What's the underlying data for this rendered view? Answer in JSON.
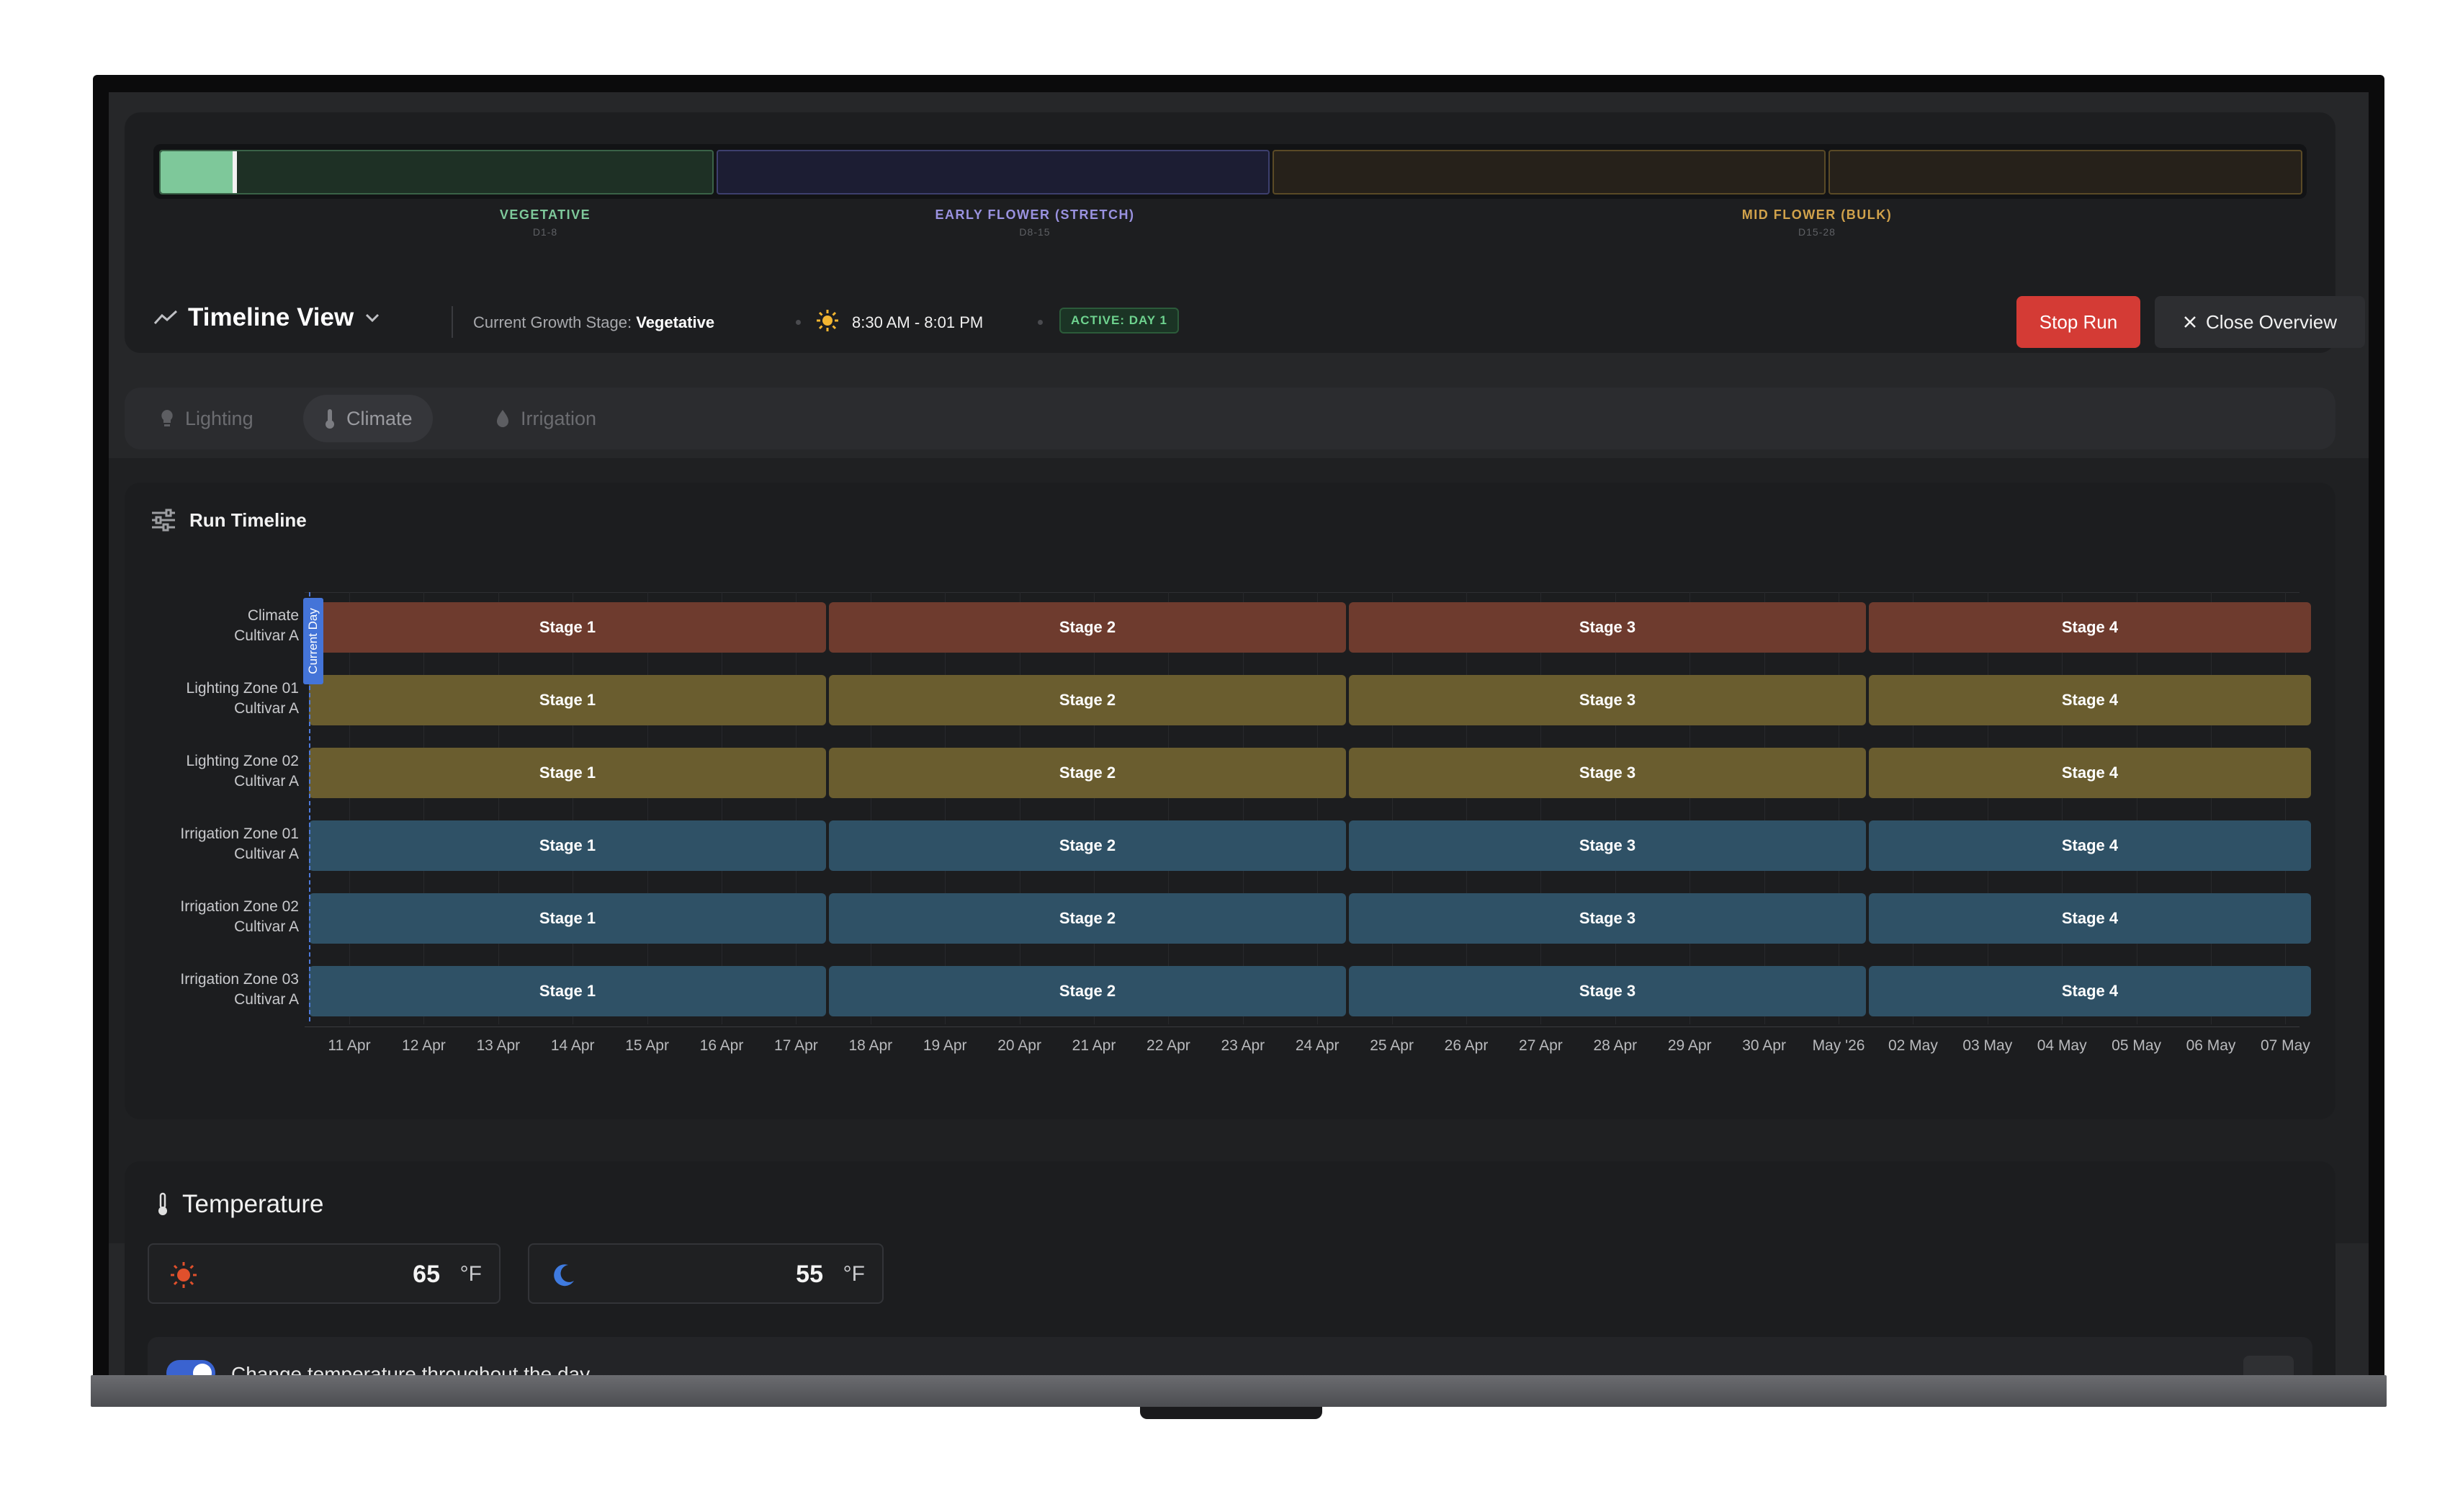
{
  "stage_bar": {
    "vegetative_label": "VEGETATIVE",
    "vegetative_range": "D1-8",
    "early_flower_label": "EARLY FLOWER (STRETCH)",
    "early_flower_range": "D8-15",
    "mid_flower_label": "MID FLOWER (BULK)",
    "mid_flower_range": "D15-28",
    "vegetative_progress_fraction": 0.13,
    "colors": {
      "vegetative": "#7ec89a",
      "early_flower": "#9a92e0",
      "mid_flower": "#d1a24b"
    }
  },
  "header": {
    "view_title": "Timeline View",
    "growth_stage_label": "Current Growth Stage:",
    "growth_stage_value": "Vegetative",
    "light_schedule": "8:30 AM - 8:01 PM",
    "active_badge": "ACTIVE: DAY 1",
    "stop_button": "Stop Run",
    "close_button": "Close Overview"
  },
  "tabs": [
    {
      "label": "Lighting",
      "icon": "bulb-icon",
      "active": false
    },
    {
      "label": "Climate",
      "icon": "thermometer-icon",
      "active": true
    },
    {
      "label": "Irrigation",
      "icon": "droplet-icon",
      "active": false
    }
  ],
  "run_timeline": {
    "title": "Run Timeline",
    "current_day_label": "Current Day",
    "rows": [
      {
        "name": "Climate",
        "sub": "Cultivar A",
        "kind": "climate",
        "stages": [
          "Stage 1",
          "Stage 2",
          "Stage 3",
          "Stage 4"
        ]
      },
      {
        "name": "Lighting Zone 01",
        "sub": "Cultivar A",
        "kind": "lighting",
        "stages": [
          "Stage 1",
          "Stage 2",
          "Stage 3",
          "Stage 4"
        ]
      },
      {
        "name": "Lighting Zone 02",
        "sub": "Cultivar A",
        "kind": "lighting",
        "stages": [
          "Stage 1",
          "Stage 2",
          "Stage 3",
          "Stage 4"
        ]
      },
      {
        "name": "Irrigation Zone 01",
        "sub": "Cultivar A",
        "kind": "irrigation",
        "stages": [
          "Stage 1",
          "Stage 2",
          "Stage 3",
          "Stage 4"
        ]
      },
      {
        "name": "Irrigation Zone 02",
        "sub": "Cultivar A",
        "kind": "irrigation",
        "stages": [
          "Stage 1",
          "Stage 2",
          "Stage 3",
          "Stage 4"
        ]
      },
      {
        "name": "Irrigation Zone 03",
        "sub": "Cultivar A",
        "kind": "irrigation",
        "stages": [
          "Stage 1",
          "Stage 2",
          "Stage 3",
          "Stage 4"
        ]
      }
    ],
    "x_ticks": [
      "11 Apr",
      "12 Apr",
      "13 Apr",
      "14 Apr",
      "15 Apr",
      "16 Apr",
      "17 Apr",
      "18 Apr",
      "19 Apr",
      "20 Apr",
      "21 Apr",
      "22 Apr",
      "23 Apr",
      "24 Apr",
      "25 Apr",
      "26 Apr",
      "27 Apr",
      "28 Apr",
      "29 Apr",
      "30 Apr",
      "May '26",
      "02 May",
      "03 May",
      "04 May",
      "05 May",
      "06 May",
      "07 May"
    ],
    "colors": {
      "climate": "#6e3b2e",
      "lighting": "#6a5d2f",
      "irrigation": "#2f5166",
      "current_day": "#4474d8"
    }
  },
  "temperature": {
    "title": "Temperature",
    "day_value": "65",
    "night_value": "55",
    "unit": "°F",
    "toggle_label": "Change temperature throughout the day",
    "toggle_on": true
  }
}
